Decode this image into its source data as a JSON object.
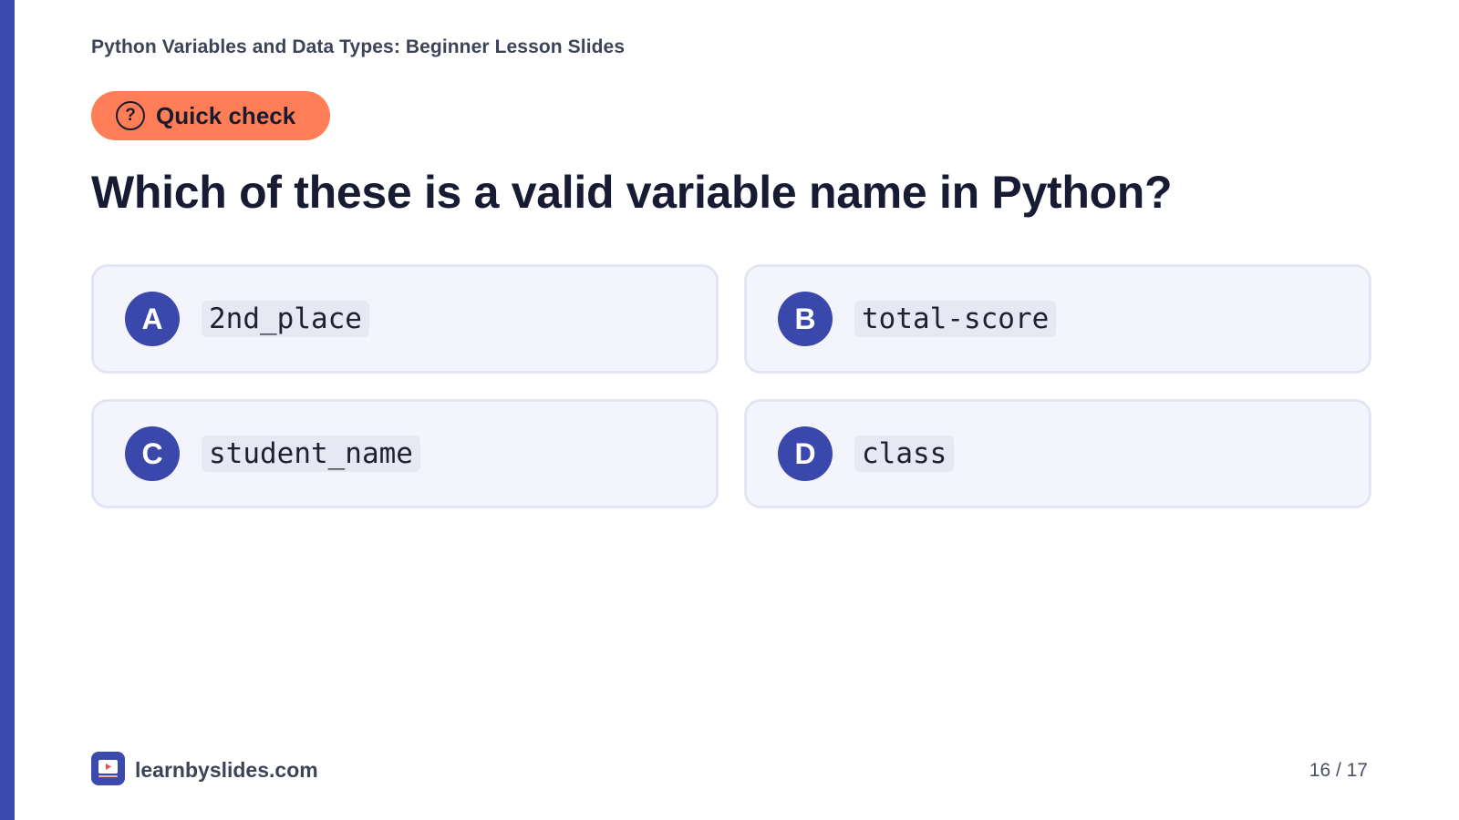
{
  "header": {
    "deck_title": "Python Variables and Data Types: Beginner Lesson Slides"
  },
  "tag": {
    "icon": "question-circle-icon",
    "icon_glyph": "?",
    "label": "Quick check"
  },
  "question": "Which of these is a valid variable name in Python?",
  "options": [
    {
      "letter": "A",
      "code": "2nd_place"
    },
    {
      "letter": "B",
      "code": "total-score"
    },
    {
      "letter": "C",
      "code": "student_name"
    },
    {
      "letter": "D",
      "code": "class"
    }
  ],
  "footer": {
    "logo_icon": "play-slide-icon",
    "site": "learnbyslides.com",
    "page": "16 / 17"
  },
  "colors": {
    "accent": "#3c49ad",
    "tag_bg": "#ff7e57",
    "option_bg": "#f4f5fc"
  }
}
